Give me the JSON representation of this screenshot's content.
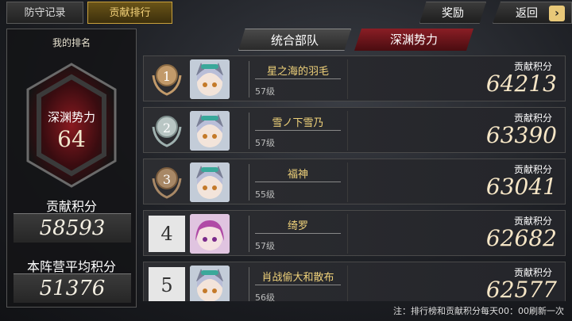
{
  "topbar": {
    "tab_defense": "防守记录",
    "tab_ranking": "贡献排行",
    "reward": "奖励",
    "back": "返回"
  },
  "left": {
    "title": "我的排名",
    "faction": "深渊势力",
    "rank": "64",
    "score_label": "贡献积分",
    "score": "58593",
    "avg_label": "本阵营平均积分",
    "avg": "51376"
  },
  "faction_tabs": {
    "unified": "统合部队",
    "abyss": "深渊势力"
  },
  "rows": [
    {
      "rank": "1",
      "name": "星之海的羽毛",
      "level": "57级",
      "score_label": "贡献积分",
      "score": "64213"
    },
    {
      "rank": "2",
      "name": "雪ノ下雪乃",
      "level": "57级",
      "score_label": "贡献积分",
      "score": "63390"
    },
    {
      "rank": "3",
      "name": "福神",
      "level": "55级",
      "score_label": "贡献积分",
      "score": "63041"
    },
    {
      "rank": "4",
      "name": "绮罗",
      "level": "57级",
      "score_label": "贡献积分",
      "score": "62682"
    },
    {
      "rank": "5",
      "name": "肖战偷大和散布",
      "level": "56级",
      "score_label": "贡献积分",
      "score": "62577"
    }
  ],
  "note": "注：排行榜和贡献积分每天00：00刷新一次"
}
